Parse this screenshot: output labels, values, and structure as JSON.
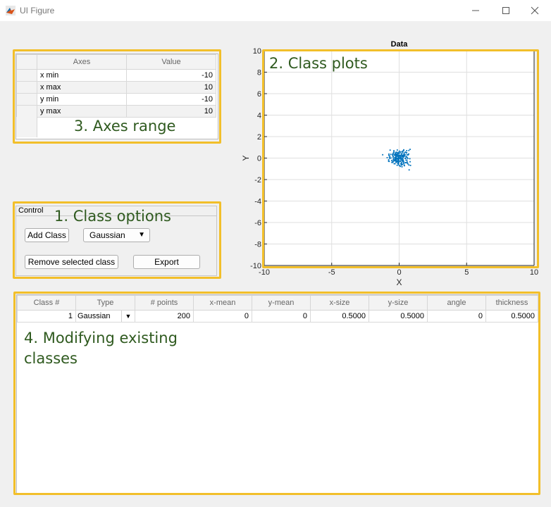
{
  "window": {
    "title": "UI Figure",
    "minimize_icon": "minimize-icon",
    "maximize_icon": "maximize-icon",
    "close_icon": "close-icon"
  },
  "axes_range": {
    "headers": [
      "Axes",
      "Value"
    ],
    "rows": [
      {
        "name": "x min",
        "value": "-10"
      },
      {
        "name": "x max",
        "value": "10"
      },
      {
        "name": "y min",
        "value": "-10"
      },
      {
        "name": "y max",
        "value": "10"
      }
    ],
    "annotation": "3. Axes range"
  },
  "control": {
    "title": "Control",
    "annotation": "1. Class options",
    "add_class_label": "Add Class",
    "type_selected": "Gaussian",
    "remove_label": "Remove selected class",
    "export_label": "Export"
  },
  "plot": {
    "annotation": "2. Class plots"
  },
  "classes_table": {
    "headers": [
      "Class #",
      "Type",
      "# points",
      "x-mean",
      "y-mean",
      "x-size",
      "y-size",
      "angle",
      "thickness"
    ],
    "rows": [
      {
        "class": "1",
        "type": "Gaussian",
        "points": "200",
        "x_mean": "0",
        "y_mean": "0",
        "x_size": "0.5000",
        "y_size": "0.5000",
        "angle": "0",
        "thickness": "0.5000"
      }
    ],
    "annotation_line1": "4. Modifying existing",
    "annotation_line2": "classes"
  },
  "chart_data": {
    "type": "scatter",
    "title": "Data",
    "xlabel": "X",
    "ylabel": "Y",
    "xlim": [
      -10,
      10
    ],
    "ylim": [
      -10,
      10
    ],
    "xticks": [
      "-10",
      "-5",
      "0",
      "5",
      "10"
    ],
    "yticks": [
      "-10",
      "-8",
      "-6",
      "-4",
      "-2",
      "0",
      "2",
      "4",
      "6",
      "8",
      "10"
    ],
    "grid": true,
    "color": "#0072bd",
    "series": [
      {
        "points": [
          [
            -0.62,
            0.35
          ],
          [
            -0.32,
            0.33
          ],
          [
            -0.35,
            -0.18
          ],
          [
            0.64,
            -0.53
          ],
          [
            -0.04,
            0.42
          ],
          [
            0.81,
            0.81
          ],
          [
            -0.39,
            0.57
          ],
          [
            0.26,
            0.17
          ],
          [
            0.31,
            0.69
          ],
          [
            -0.27,
            0.47
          ],
          [
            0.64,
            -0.03
          ],
          [
            -0.31,
            -0.25
          ],
          [
            0.37,
            -0.64
          ],
          [
            -0.23,
            -0.39
          ],
          [
            -0.11,
            -0.03
          ],
          [
            0.1,
            -0.26
          ],
          [
            -0.89,
            0.04
          ],
          [
            0.11,
            -0.09
          ],
          [
            -0.15,
            0.53
          ],
          [
            -0.29,
            0.26
          ],
          [
            -0.51,
            -0.41
          ],
          [
            -0.24,
            0.04
          ],
          [
            0.26,
            0.26
          ],
          [
            0.16,
            -0.51
          ],
          [
            0.12,
            0.07
          ],
          [
            -0.48,
            -0.33
          ],
          [
            -0.01,
            0.27
          ],
          [
            0.25,
            0.56
          ],
          [
            -0.54,
            -0.4
          ],
          [
            0.56,
            0.69
          ],
          [
            -0.12,
            0.12
          ],
          [
            0.19,
            -0.43
          ],
          [
            0.12,
            0.58
          ],
          [
            -0.28,
            0.3
          ],
          [
            0.13,
            0.26
          ],
          [
            0.24,
            -0.28
          ],
          [
            0.45,
            -0.43
          ],
          [
            -0.07,
            -0.26
          ],
          [
            -0.34,
            0.3
          ],
          [
            -0.16,
            -0.32
          ],
          [
            0.04,
            0.02
          ],
          [
            -0.31,
            -0.53
          ],
          [
            -1.22,
            0.31
          ],
          [
            0.34,
            0.26
          ],
          [
            -0.19,
            0.25
          ],
          [
            -0.46,
            -0.36
          ],
          [
            0.37,
            0.17
          ],
          [
            -0.08,
            -0.1
          ],
          [
            0.79,
            -0.06
          ],
          [
            0.51,
            -0.43
          ],
          [
            0.16,
            -0.03
          ],
          [
            -0.25,
            -0.18
          ],
          [
            0.58,
            0.31
          ],
          [
            -0.45,
            0.17
          ],
          [
            0.27,
            -0.07
          ],
          [
            0.06,
            0.25
          ],
          [
            0.67,
            0.3
          ],
          [
            -0.04,
            0.04
          ],
          [
            0.13,
            0.09
          ],
          [
            -0.02,
            0.54
          ],
          [
            -0.39,
            0.69
          ],
          [
            0.12,
            -0.53
          ],
          [
            -0.14,
            0.75
          ],
          [
            -0.17,
            0.28
          ],
          [
            0.33,
            -0.29
          ],
          [
            -0.42,
            -0.04
          ],
          [
            -0.78,
            -0.16
          ],
          [
            0.29,
            0.12
          ],
          [
            0.24,
            -0.19
          ],
          [
            0.0,
            0.21
          ],
          [
            -0.23,
            -0.21
          ],
          [
            0.0,
            0.14
          ],
          [
            -0.11,
            0.18
          ],
          [
            -0.48,
            0.27
          ],
          [
            0.24,
            0.62
          ],
          [
            -0.15,
            -0.67
          ],
          [
            -0.27,
            0.05
          ],
          [
            -0.45,
            0.1
          ],
          [
            0.71,
            0.38
          ],
          [
            -0.16,
            -0.31
          ],
          [
            0.07,
            0.0
          ],
          [
            0.52,
            0.49
          ],
          [
            -0.22,
            0.13
          ],
          [
            -0.16,
            -0.03
          ],
          [
            -0.23,
            -0.4
          ],
          [
            0.29,
            -0.18
          ],
          [
            0.12,
            0.04
          ],
          [
            -0.03,
            -0.39
          ],
          [
            -0.05,
            -0.59
          ],
          [
            -0.37,
            -0.52
          ],
          [
            -0.29,
            0.39
          ],
          [
            0.39,
            0.23
          ],
          [
            -0.1,
            -0.31
          ],
          [
            0.11,
            -0.32
          ],
          [
            -0.26,
            -0.03
          ],
          [
            0.21,
            0.24
          ],
          [
            0.56,
            0.49
          ],
          [
            -0.33,
            0.05
          ],
          [
            -0.23,
            0.1
          ],
          [
            -0.01,
            -0.07
          ],
          [
            0.21,
            0.44
          ],
          [
            0.25,
            -0.59
          ],
          [
            -0.29,
            -0.16
          ],
          [
            0.45,
            -0.04
          ],
          [
            -0.76,
            0.25
          ],
          [
            0.84,
            -0.68
          ],
          [
            0.34,
            0.77
          ],
          [
            -0.41,
            -0.27
          ],
          [
            -0.16,
            0.28
          ],
          [
            -0.42,
            0.47
          ],
          [
            -0.22,
            -0.3
          ],
          [
            -0.61,
            0.01
          ],
          [
            0.08,
            0.19
          ],
          [
            -0.22,
            -0.1
          ],
          [
            0.01,
            -0.69
          ],
          [
            -0.14,
            0.36
          ],
          [
            -0.55,
            -0.22
          ],
          [
            -0.13,
            -0.27
          ],
          [
            0.16,
            -0.16
          ],
          [
            0.31,
            0.22
          ],
          [
            0.21,
            -0.81
          ],
          [
            0.47,
            0.56
          ],
          [
            0.32,
            -0.4
          ],
          [
            0.48,
            -0.02
          ],
          [
            -0.78,
            -0.29
          ],
          [
            0.23,
            0.16
          ],
          [
            0.81,
            -0.34
          ],
          [
            0.18,
            0.37
          ],
          [
            -0.05,
            -0.08
          ],
          [
            0.26,
            -0.29
          ],
          [
            -0.1,
            0.47
          ],
          [
            -0.11,
            -0.12
          ],
          [
            0.72,
            -0.64
          ],
          [
            -0.67,
            0.74
          ],
          [
            0.29,
            0.06
          ],
          [
            0.37,
            0.39
          ],
          [
            0.32,
            0.67
          ],
          [
            -0.46,
            0.41
          ],
          [
            0.44,
            0.3
          ],
          [
            -0.43,
            -0.16
          ],
          [
            0.21,
            0.24
          ],
          [
            -0.7,
            -0.02
          ],
          [
            0.06,
            0.47
          ],
          [
            0.19,
            -0.6
          ],
          [
            0.16,
            -0.66
          ],
          [
            0.27,
            0.16
          ],
          [
            0.08,
            -0.77
          ],
          [
            -0.09,
            -0.5
          ],
          [
            0.72,
            0.71
          ],
          [
            -0.74,
            -0.31
          ],
          [
            0.04,
            0.18
          ],
          [
            -0.11,
            -0.15
          ],
          [
            0.39,
            -0.71
          ],
          [
            -0.1,
            0.25
          ],
          [
            0.11,
            -0.03
          ],
          [
            0.34,
            -0.49
          ],
          [
            -0.72,
            0.06
          ],
          [
            0.37,
            0.48
          ],
          [
            -0.2,
            0.38
          ],
          [
            -0.22,
            -0.03
          ],
          [
            0.11,
            -0.29
          ],
          [
            0.74,
            -1.1
          ],
          [
            -0.76,
            0.37
          ],
          [
            0.2,
            0.15
          ],
          [
            0.13,
            -0.08
          ],
          [
            0.32,
            0.26
          ],
          [
            -0.31,
            0.24
          ],
          [
            -0.24,
            0.15
          ],
          [
            -0.05,
            -0.48
          ],
          [
            0.51,
            -0.19
          ],
          [
            -0.45,
            0.34
          ],
          [
            0.02,
            0.64
          ],
          [
            -0.06,
            -0.26
          ],
          [
            0.35,
            0.32
          ],
          [
            0.03,
            -0.28
          ],
          [
            0.02,
            0.26
          ],
          [
            -0.18,
            0.3
          ],
          [
            -0.29,
            -0.05
          ],
          [
            0.59,
            0.05
          ],
          [
            -0.02,
            0.09
          ],
          [
            -0.09,
            0.39
          ],
          [
            0.21,
            -0.01
          ],
          [
            -0.11,
            -0.44
          ],
          [
            0.58,
            -0.2
          ],
          [
            0.59,
            -0.36
          ],
          [
            -0.32,
            0.32
          ],
          [
            -0.09,
            0.2
          ],
          [
            -0.23,
            0.54
          ],
          [
            0.55,
            0.13
          ],
          [
            0.5,
            0.13
          ],
          [
            0.12,
            0.02
          ],
          [
            0.11,
            -0.04
          ],
          [
            0.62,
            -0.47
          ],
          [
            -0.31,
            -0.11
          ],
          [
            -0.69,
            0.18
          ],
          [
            -0.05,
            -0.18
          ],
          [
            -0.49,
            0.31
          ],
          [
            0.37,
            0.14
          ]
        ]
      }
    ]
  }
}
